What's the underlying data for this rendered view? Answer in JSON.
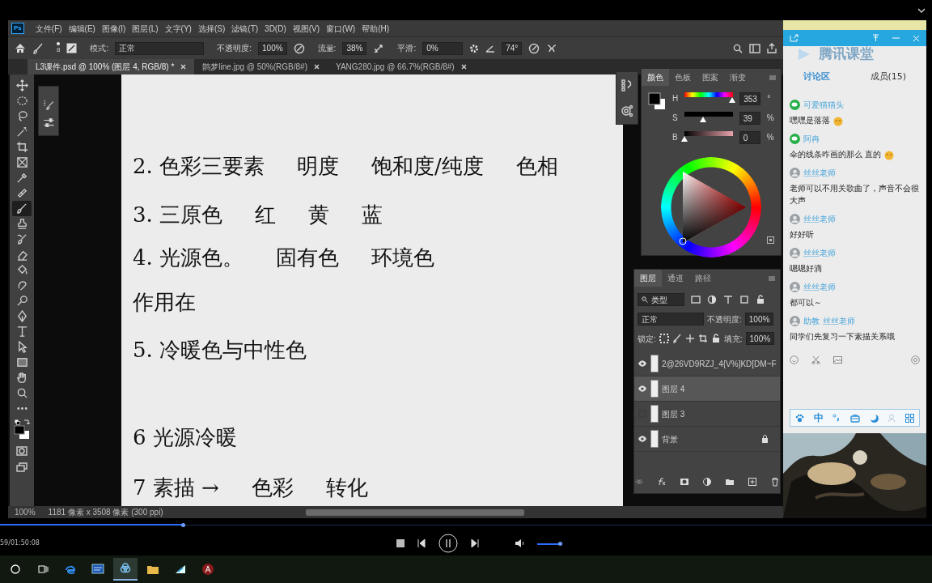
{
  "photoshop": {
    "logo": "Ps",
    "menu": [
      "文件(F)",
      "编辑(E)",
      "图像(I)",
      "图层(L)",
      "文字(Y)",
      "选择(S)",
      "滤镜(T)",
      "3D(D)",
      "视图(V)",
      "窗口(W)",
      "帮助(H)"
    ],
    "options": {
      "brush_size": "8",
      "mode_label": "模式:",
      "mode": "正常",
      "opacity_label": "不透明度:",
      "opacity": "100%",
      "flow_label": "流量:",
      "flow": "38%",
      "smoothing_label": "平滑:",
      "smoothing": "0%",
      "angle": "74°"
    },
    "tabs": [
      {
        "label": "L3课件.psd @ 100% (图层 4, RGB/8) *",
        "selected": true
      },
      {
        "label": "鹊梦line.jpg @ 50%(RGB/8#)",
        "selected": false
      },
      {
        "label": "YANG280.jpg @ 66.7%(RGB/8#)",
        "selected": false
      }
    ],
    "tools": [
      {
        "kind": "move",
        "selected": false
      },
      {
        "kind": "marquee",
        "selected": false
      },
      {
        "kind": "lasso",
        "selected": false
      },
      {
        "kind": "wand",
        "selected": false
      },
      {
        "kind": "crop",
        "selected": false
      },
      {
        "kind": "frame",
        "selected": false
      },
      {
        "kind": "eyedropper",
        "selected": false
      },
      {
        "kind": "bandage",
        "selected": false
      },
      {
        "kind": "brush",
        "selected": true
      },
      {
        "kind": "stamp",
        "selected": false
      },
      {
        "kind": "history",
        "selected": false
      },
      {
        "kind": "eraser",
        "selected": false
      },
      {
        "kind": "bucket",
        "selected": false
      },
      {
        "kind": "smudge",
        "selected": false
      },
      {
        "kind": "dodge",
        "selected": false
      },
      {
        "kind": "pen",
        "selected": false
      },
      {
        "kind": "type",
        "selected": false
      },
      {
        "kind": "select",
        "selected": false
      },
      {
        "kind": "rectangle",
        "selected": false
      },
      {
        "kind": "hand",
        "selected": false
      },
      {
        "kind": "zoom",
        "selected": false
      },
      {
        "kind": "more",
        "selected": false
      }
    ],
    "canvas_lines": [
      {
        "parts": [
          "2. 色彩三要素",
          "明度",
          "饱和度/纯度",
          "色相"
        ]
      },
      {
        "parts": [
          "3. 三原色",
          "红",
          "黄",
          "蓝"
        ]
      },
      {
        "parts": [
          "4. 光源色。",
          "固有色",
          "环境色"
        ]
      },
      {
        "parts": [
          "作用在"
        ]
      },
      {
        "parts": [
          "5. 冷暖色与中性色"
        ]
      },
      {
        "parts": [
          "6  光源冷暖"
        ]
      },
      {
        "parts": [
          "7  素描 →",
          "色彩",
          "转化"
        ]
      }
    ],
    "color_panel": {
      "tabs": [
        {
          "label": "颜色",
          "selected": true
        },
        {
          "label": "色板",
          "selected": false
        },
        {
          "label": "图案",
          "selected": false
        },
        {
          "label": "渐变",
          "selected": false
        }
      ],
      "sliders": [
        {
          "label": "H",
          "value": "353",
          "unit": "°",
          "level": 0.98
        },
        {
          "label": "S",
          "value": "39",
          "unit": "%",
          "level": 0.39
        },
        {
          "label": "B",
          "value": "0",
          "unit": "%",
          "level": 0
        }
      ]
    },
    "layers_panel": {
      "tabs": [
        {
          "label": "图层",
          "selected": true
        },
        {
          "label": "通道",
          "selected": false
        },
        {
          "label": "路径",
          "selected": false
        }
      ],
      "filter": "类型",
      "blend_mode": "正常",
      "opacity_label": "不透明度:",
      "opacity": "100%",
      "lock_label": "锁定:",
      "fill_label": "填充:",
      "fill": "100%",
      "layers": [
        {
          "name": "2@26VD9RZJ_4{V%]KD[DM~F",
          "visible": true,
          "selected": false,
          "locked": false
        },
        {
          "name": "图层 4",
          "visible": true,
          "selected": true,
          "locked": false
        },
        {
          "name": "图层 3",
          "visible": false,
          "selected": false,
          "locked": false
        },
        {
          "name": "背景",
          "visible": true,
          "selected": false,
          "locked": true
        }
      ]
    },
    "status": {
      "zoom": "100%",
      "doc_size": "1181 像素 x 3508 像素 (300 ppi)"
    }
  },
  "chat": {
    "title": "腾讯课堂",
    "tabs": [
      {
        "label": "讨论区",
        "selected": true
      },
      {
        "label": "成员(15)",
        "selected": false
      }
    ],
    "messages": [
      {
        "kind": "wechat",
        "sender": "可爱猫猫头",
        "text": "嘿嘿是落落",
        "emoji": true
      },
      {
        "kind": "wechat",
        "sender": "阿冉",
        "text": "伞的线条咋画的那么 直的",
        "emoji": true
      },
      {
        "kind": "avatar",
        "sender": "丝丝老师",
        "text": "老师可以不用关歌曲了，声音不会很大声",
        "emoji": false
      },
      {
        "kind": "avatar",
        "sender": "丝丝老师",
        "text": "好好听",
        "emoji": false
      },
      {
        "kind": "avatar",
        "sender": "丝丝老师",
        "text": "嗯嗯好滴",
        "emoji": false
      },
      {
        "kind": "avatar",
        "sender": "丝丝老师",
        "text": "都可以～",
        "emoji": false
      },
      {
        "kind": "avatar",
        "role": "助教",
        "sender": "丝丝老师",
        "text": "同学们先复习一下素描关系哦",
        "emoji": false
      }
    ],
    "ime_label": "中"
  },
  "player": {
    "progress": {
      "level": 0.196
    },
    "time": "59/01:50:08",
    "playing": true,
    "volume": {
      "level": 0.87
    }
  },
  "taskbar": [
    {
      "kind": "search",
      "selected": false
    },
    {
      "kind": "taskview",
      "selected": false
    },
    {
      "kind": "edge",
      "selected": false
    },
    {
      "kind": "monitor",
      "selected": false
    },
    {
      "kind": "cloud",
      "selected": true
    },
    {
      "kind": "folder",
      "selected": false
    },
    {
      "kind": "player",
      "selected": false
    },
    {
      "kind": "redapp",
      "selected": false
    }
  ]
}
